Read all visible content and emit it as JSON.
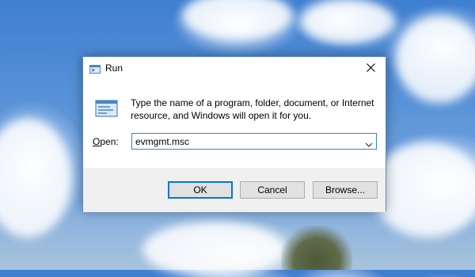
{
  "dialog": {
    "title": "Run",
    "description": "Type the name of a program, folder, document, or Internet resource, and Windows will open it for you.",
    "open_label": {
      "accel": "O",
      "rest": "pen:"
    },
    "open_value": "evmgmt.msc",
    "buttons": {
      "ok": "OK",
      "cancel": "Cancel",
      "browse": "Browse..."
    }
  },
  "icons": {
    "title": "run-icon",
    "body": "run-icon",
    "close": "close-icon",
    "dropdown": "chevron-down-icon"
  },
  "colors": {
    "accent": "#0078d7",
    "dialog_border": "#5b89c4",
    "footer_bg": "#f0f0f0"
  }
}
